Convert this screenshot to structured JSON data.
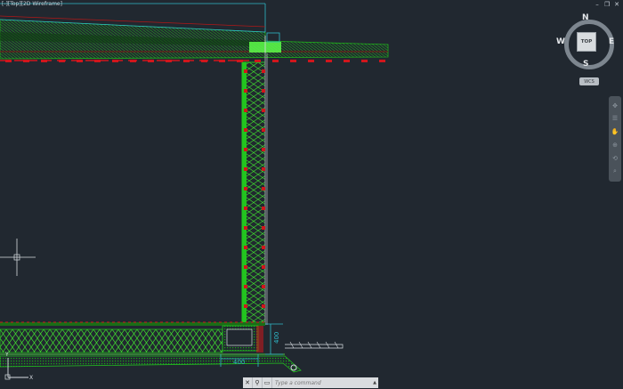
{
  "viewport": {
    "label": "[-][Top][2D Wireframe]"
  },
  "window_controls": {
    "minimize": "–",
    "restore": "❐",
    "close": "✕"
  },
  "viewcube": {
    "top_face": "TOP",
    "north": "N",
    "south": "S",
    "east": "E",
    "west": "W",
    "wcs_menu": "WCS"
  },
  "navbar": {
    "tools": [
      "✥",
      "☰",
      "✋",
      "⊕",
      "⟲",
      "⌕"
    ]
  },
  "dimensions": {
    "horizontal": "400",
    "vertical": "400"
  },
  "command_line": {
    "close_icon": "✕",
    "customize_icon": "⚲",
    "recent_icon": "▭",
    "placeholder": "Type a command",
    "dropdown": "▲"
  },
  "colors": {
    "background": "#212830",
    "insulation_green": "#22c41f",
    "bright_green": "#5dff4a",
    "red": "#d0161c",
    "dark_red": "#7a1515",
    "cyan": "#2fb9c9",
    "crosshair": "#d8dde2"
  }
}
